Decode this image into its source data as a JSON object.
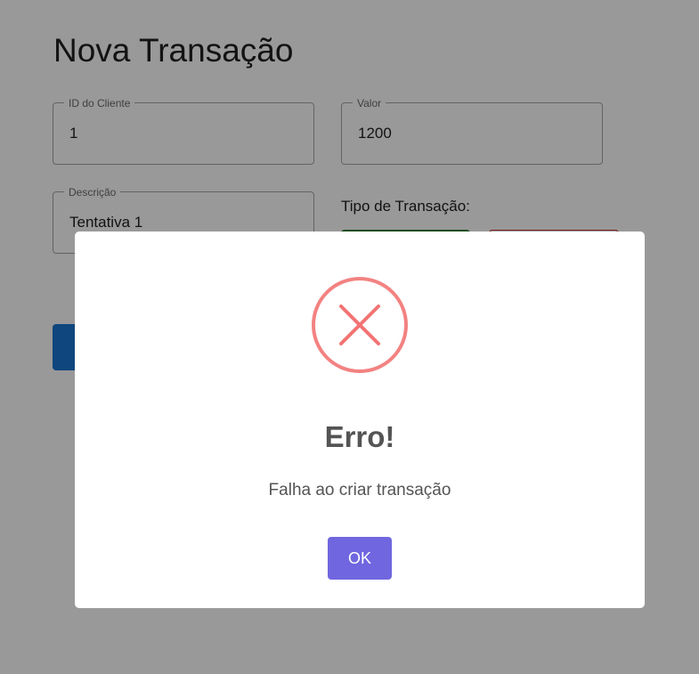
{
  "form": {
    "title": "Nova Transação",
    "client_id": {
      "label": "ID do Cliente",
      "value": "1"
    },
    "amount": {
      "label": "Valor",
      "value": "1200"
    },
    "description": {
      "label": "Descrição",
      "value": "Tentativa 1"
    },
    "type_label": "Tipo de Transação:"
  },
  "dialog": {
    "icon": "error-x-icon",
    "title": "Erro!",
    "message": "Falha ao criar transação",
    "ok_label": "OK"
  },
  "colors": {
    "overlay": "#999999",
    "error_icon": "#f27474",
    "confirm_button": "#7066e0",
    "credit_button": "#2e7d32",
    "submit_button": "#1976d2"
  }
}
